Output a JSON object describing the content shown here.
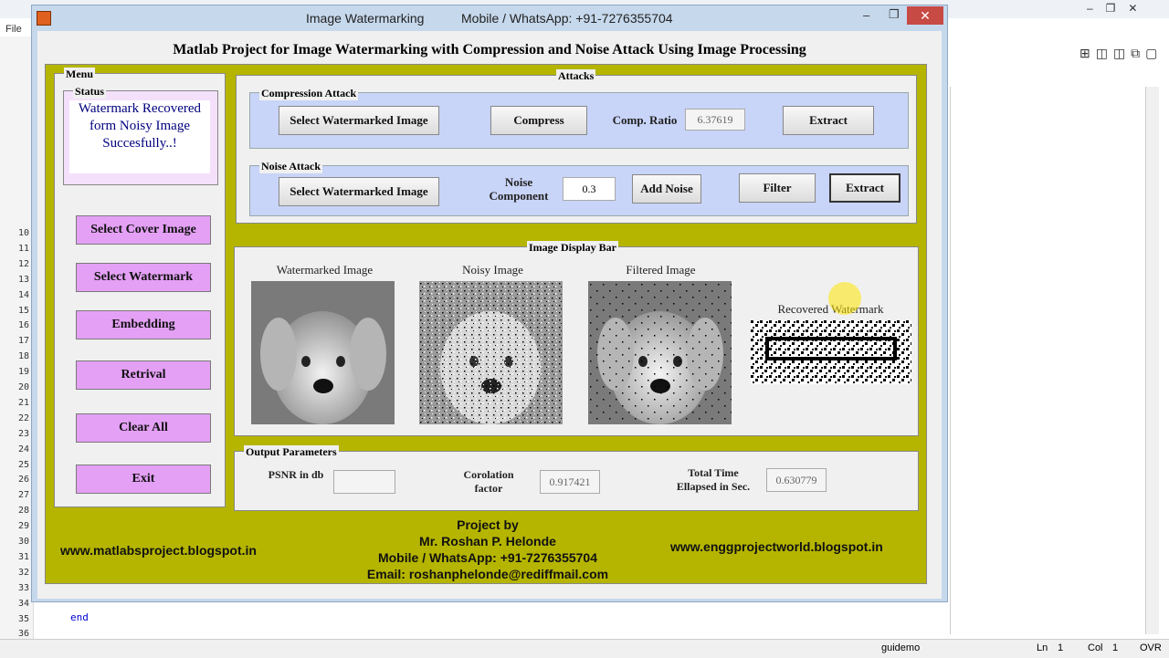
{
  "editor": {
    "menu_file": "File",
    "line_numbers": [
      "10",
      "11",
      "12",
      "13",
      "14",
      "15",
      "16",
      "17",
      "18",
      "19",
      "20",
      "21",
      "22",
      "23",
      "24",
      "25",
      "26",
      "27",
      "28",
      "29",
      "30",
      "31",
      "32",
      "33",
      "34",
      "35",
      "36"
    ],
    "code_end": "end",
    "status_fn": "guidemo",
    "status_ln_label": "Ln",
    "status_ln": "1",
    "status_col_label": "Col",
    "status_col": "1",
    "status_ovr": "OVR"
  },
  "window": {
    "title": "Image Watermarking",
    "title_contact": "Mobile / WhatsApp: +91-7276355704",
    "heading": "Matlab Project for Image Watermarking with Compression and Noise Attack Using Image Processing"
  },
  "menu": {
    "title": "Menu",
    "status_title": "Status",
    "status_message": "Watermark Recovered form Noisy Image Succesfully..!",
    "buttons": [
      "Select Cover Image",
      "Select Watermark",
      "Embedding",
      "Retrival",
      "Clear All",
      "Exit"
    ]
  },
  "attacks": {
    "title": "Attacks",
    "compression": {
      "title": "Compression Attack",
      "select_label": "Select Watermarked Image",
      "compress_label": "Compress",
      "ratio_label": "Comp. Ratio",
      "ratio_value": "6.37619",
      "extract_label": "Extract"
    },
    "noise": {
      "title": "Noise Attack",
      "select_label": "Select Watermarked Image",
      "component_label": "Noise Component",
      "component_value": "0.3",
      "add_noise_label": "Add Noise",
      "filter_label": "Filter",
      "extract_label": "Extract"
    }
  },
  "display": {
    "title": "Image Display Bar",
    "captions": [
      "Watermarked Image",
      "Noisy Image",
      "Filtered Image",
      "Recovered Watermark"
    ]
  },
  "output": {
    "title": "Output Parameters",
    "psnr_label": "PSNR in db",
    "psnr_value": "",
    "corr_label": "Corolation factor",
    "corr_value": "0.917421",
    "time_label": "Total Time Ellapsed in Sec.",
    "time_value": "0.630779"
  },
  "footer": {
    "left_url": "www.matlabsproject.blogspot.in",
    "right_url": "www.enggprojectworld.blogspot.in",
    "project_by": "Project by",
    "author": "Mr. Roshan P. Helonde",
    "mobile": "Mobile / WhatsApp: +91-7276355704",
    "email": "Email: roshanphelonde@rediffmail.com"
  },
  "colors": {
    "client_bg": "#b5b500",
    "purple_button": "#e4a0f5",
    "attack_panel": "#c8d4f8"
  }
}
